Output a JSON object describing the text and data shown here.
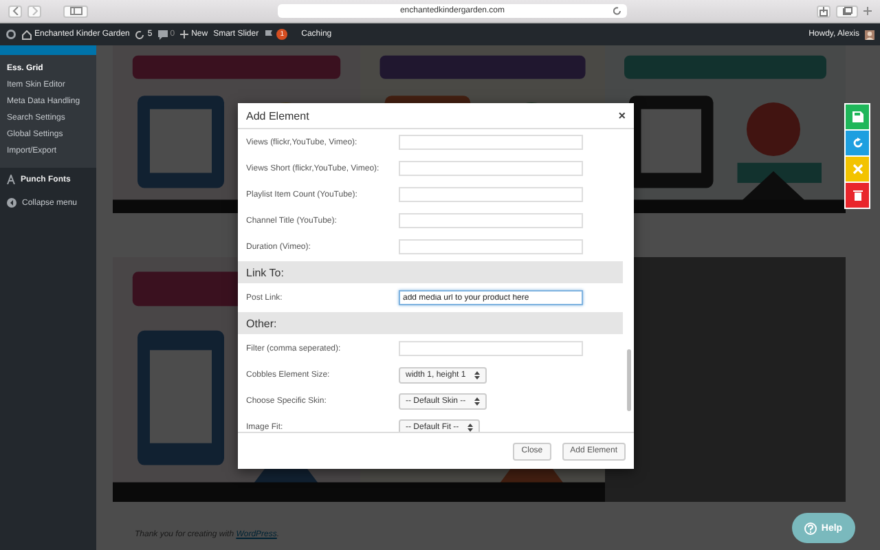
{
  "browser": {
    "address": "enchantedkindergarden.com"
  },
  "admin_bar": {
    "site": "Enchanted Kinder Garden",
    "updates": "5",
    "comments": "0",
    "new": "New",
    "slider": "Smart Slider",
    "notifications": "1",
    "caching": "Caching",
    "greeting": "Howdy, Alexis"
  },
  "sidebar": {
    "items": [
      {
        "label": "Ess. Grid",
        "selected": true
      },
      {
        "label": "Item Skin Editor",
        "selected": false
      },
      {
        "label": "Meta Data Handling",
        "selected": false
      },
      {
        "label": "Search Settings",
        "selected": false
      },
      {
        "label": "Global Settings",
        "selected": false
      },
      {
        "label": "Import/Export",
        "selected": false
      }
    ],
    "plugin": "Punch Fonts",
    "collapse": "Collapse menu"
  },
  "grid": {
    "tiles": [
      {
        "kind": "picture"
      },
      {
        "kind": "picture"
      },
      {
        "kind": "picture"
      },
      {
        "kind": "picture"
      },
      {
        "kind": "picture"
      },
      {
        "kind": "empty"
      }
    ]
  },
  "side_buttons": [
    {
      "kind": "save",
      "color": "#1fb75a"
    },
    {
      "kind": "refresh",
      "color": "#1e9fe0"
    },
    {
      "kind": "cancel",
      "color": "#f3c300"
    },
    {
      "kind": "delete",
      "color": "#e9262c"
    }
  ],
  "modal": {
    "title": "Add Element",
    "close": "×",
    "sections": [
      {
        "rows": [
          {
            "label": "Views (flickr,YouTube, Vimeo):",
            "kind": "input"
          },
          {
            "label": "Views Short (flickr,YouTube, Vimeo):",
            "kind": "input"
          },
          {
            "label": "Playlist Item Count (YouTube):",
            "kind": "input"
          },
          {
            "label": "Channel Title (YouTube):",
            "kind": "input"
          },
          {
            "label": "Duration (Vimeo):",
            "kind": "input"
          }
        ]
      },
      {
        "title": "Link To:",
        "rows": [
          {
            "label": "Post Link:",
            "kind": "input",
            "value": "add media url to your product here",
            "focused": true
          }
        ]
      },
      {
        "title": "Other:",
        "rows": [
          {
            "label": "Filter (comma seperated):",
            "kind": "input"
          },
          {
            "label": "Cobbles Element Size:",
            "kind": "select",
            "value": "width 1, height 1"
          },
          {
            "label": "Choose Specific Skin:",
            "kind": "select",
            "value": "-- Default Skin --"
          },
          {
            "label": "Image Fit:",
            "kind": "select",
            "value": "-- Default Fit --"
          }
        ]
      }
    ],
    "buttons": [
      "Close",
      "Add Element"
    ]
  },
  "footer": {
    "text": "Thank you for creating with ",
    "link": "WordPress",
    "end": "."
  },
  "help": "Help"
}
